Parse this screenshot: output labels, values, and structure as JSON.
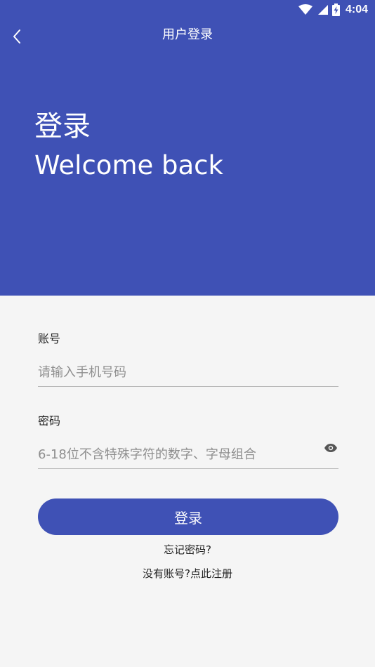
{
  "status_bar": {
    "time": "4:04",
    "icons": [
      "wifi-icon",
      "cellular-signal-icon",
      "battery-charging-icon"
    ]
  },
  "app_bar": {
    "title": "用户登录",
    "back_icon": "chevron-left-icon"
  },
  "hero": {
    "title": "登录",
    "subtitle": "Welcome back"
  },
  "form": {
    "account": {
      "label": "账号",
      "value": "",
      "placeholder": "请输入手机号码"
    },
    "password": {
      "label": "密码",
      "value": "",
      "placeholder": "6-18位不含特殊字符的数字、字母组合",
      "toggle_icon": "eye-icon"
    },
    "submit_label": "登录"
  },
  "links": {
    "forgot_password": "忘记密码?",
    "register": "没有账号?点此注册"
  },
  "colors": {
    "primary": "#3f51b5",
    "background": "#f5f5f5",
    "text": "#222222",
    "placeholder": "#8e8e8e",
    "divider": "#b8b8b8"
  }
}
